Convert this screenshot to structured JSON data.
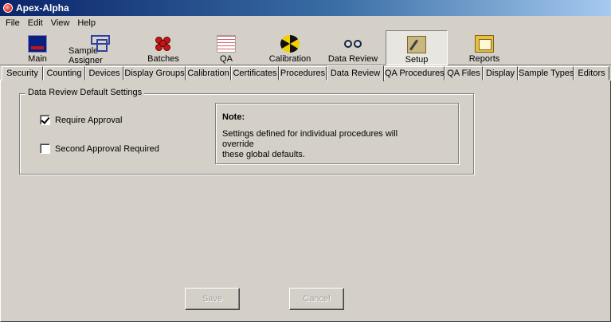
{
  "window": {
    "title": "Apex-Alpha"
  },
  "menu": [
    "File",
    "Edit",
    "View",
    "Help"
  ],
  "toolbar": [
    {
      "label": "Main",
      "icon": "monitor-icon"
    },
    {
      "label": "Sample Assigner",
      "icon": "sample-assigner-icon"
    },
    {
      "label": "Batches",
      "icon": "batches-icon"
    },
    {
      "label": "QA",
      "icon": "qa-chart-icon"
    },
    {
      "label": "Calibration",
      "icon": "radiation-icon"
    },
    {
      "label": "Data Review",
      "icon": "glasses-icon"
    },
    {
      "label": "Setup",
      "icon": "tools-icon",
      "active": true
    },
    {
      "label": "Reports",
      "icon": "reports-folder-icon"
    }
  ],
  "tabs": [
    "Security",
    "Counting",
    "Devices",
    "Display Groups",
    "Calibration",
    "Certificates",
    "Procedures",
    "Data Review",
    "QA Procedures",
    "QA Files",
    "Display",
    "Sample Types",
    "Editors"
  ],
  "selected_tab": "Data Review",
  "group": {
    "title": "Data Review Default Settings",
    "require_approval": {
      "label": "Require Approval",
      "checked": true
    },
    "second_approval": {
      "label": "Second Approval Required",
      "checked": false
    }
  },
  "note": {
    "title": "Note:",
    "text_line1": "Settings defined for individual procedures will override",
    "text_line2": "these global defaults."
  },
  "buttons": {
    "save": "Save",
    "cancel": "Cancel"
  }
}
